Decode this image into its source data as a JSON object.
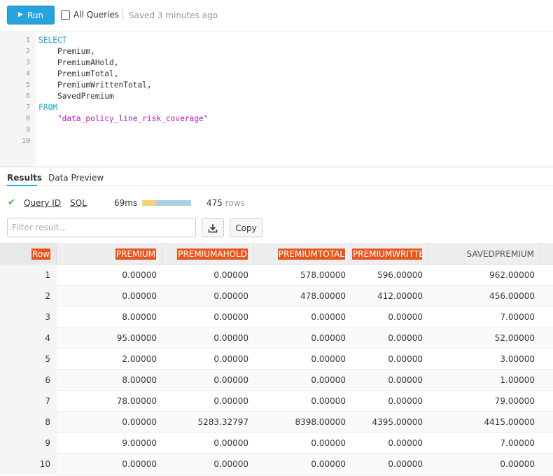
{
  "toolbar": {
    "run_label": "Run",
    "all_queries_label": "All Queries",
    "saved_status": "Saved 3 minutes ago"
  },
  "editor": {
    "line_numbers": [
      "1",
      "2",
      "3",
      "4",
      "5",
      "6",
      "7",
      "8",
      "9",
      "10"
    ],
    "lines": [
      {
        "text": "SELECT",
        "kind": "keyword"
      },
      {
        "text": "    Premium,",
        "kind": "plain"
      },
      {
        "text": "    PremiumAHold,",
        "kind": "plain"
      },
      {
        "text": "    PremiumTotal,",
        "kind": "plain"
      },
      {
        "text": "    PremiumWrittenTotal,",
        "kind": "plain"
      },
      {
        "text": "    SavedPremium",
        "kind": "plain"
      },
      {
        "text": "FROM",
        "kind": "keyword"
      },
      {
        "text": "    \"data_policy_line_risk_coverage\"",
        "kind": "string"
      },
      {
        "text": "",
        "kind": "plain"
      },
      {
        "text": "",
        "kind": "plain"
      }
    ]
  },
  "tabs": [
    {
      "label": "Results",
      "active": true
    },
    {
      "label": "Data Preview",
      "active": false
    }
  ],
  "status": {
    "query_id_label": "Query ID",
    "sql_label": "SQL",
    "time": "69ms",
    "row_count": "475",
    "rows_word": "rows"
  },
  "filter": {
    "placeholder": "Filter result...",
    "value": ""
  },
  "actions": {
    "download_icon": "download-icon",
    "copy_label": "Copy"
  },
  "table": {
    "columns": [
      {
        "label": "Row",
        "highlight": true
      },
      {
        "label": "PREMIUM",
        "highlight": true
      },
      {
        "label": "PREMIUMAHOLD",
        "highlight": true
      },
      {
        "label": "PREMIUMTOTAL",
        "highlight": true
      },
      {
        "label": "PREMIUMWRITTE",
        "highlight": true
      },
      {
        "label": "SAVEDPREMIUM",
        "highlight": false
      }
    ],
    "rows": [
      [
        "1",
        "0.00000",
        "0.00000",
        "578.00000",
        "596.00000",
        "962.00000"
      ],
      [
        "2",
        "0.00000",
        "0.00000",
        "478.00000",
        "412.00000",
        "456.00000"
      ],
      [
        "3",
        "8.00000",
        "0.00000",
        "0.00000",
        "0.00000",
        "7.00000"
      ],
      [
        "4",
        "95.00000",
        "0.00000",
        "0.00000",
        "0.00000",
        "52.00000"
      ],
      [
        "5",
        "2.00000",
        "0.00000",
        "0.00000",
        "0.00000",
        "3.00000"
      ],
      [
        "6",
        "8.00000",
        "0.00000",
        "0.00000",
        "0.00000",
        "1.00000"
      ],
      [
        "7",
        "78.00000",
        "0.00000",
        "0.00000",
        "0.00000",
        "79.00000"
      ],
      [
        "8",
        "0.00000",
        "5283.32797",
        "8398.00000",
        "4395.00000",
        "4415.00000"
      ],
      [
        "9",
        "9.00000",
        "0.00000",
        "0.00000",
        "0.00000",
        "7.00000"
      ],
      [
        "10",
        "0.00000",
        "0.00000",
        "0.00000",
        "0.00000",
        "0.00000"
      ]
    ]
  },
  "colors": {
    "accent": "#29a3e0",
    "highlight": "#e8561f",
    "success": "#4caf50",
    "keyword": "#2aa1c9",
    "string": "#b019b5"
  }
}
